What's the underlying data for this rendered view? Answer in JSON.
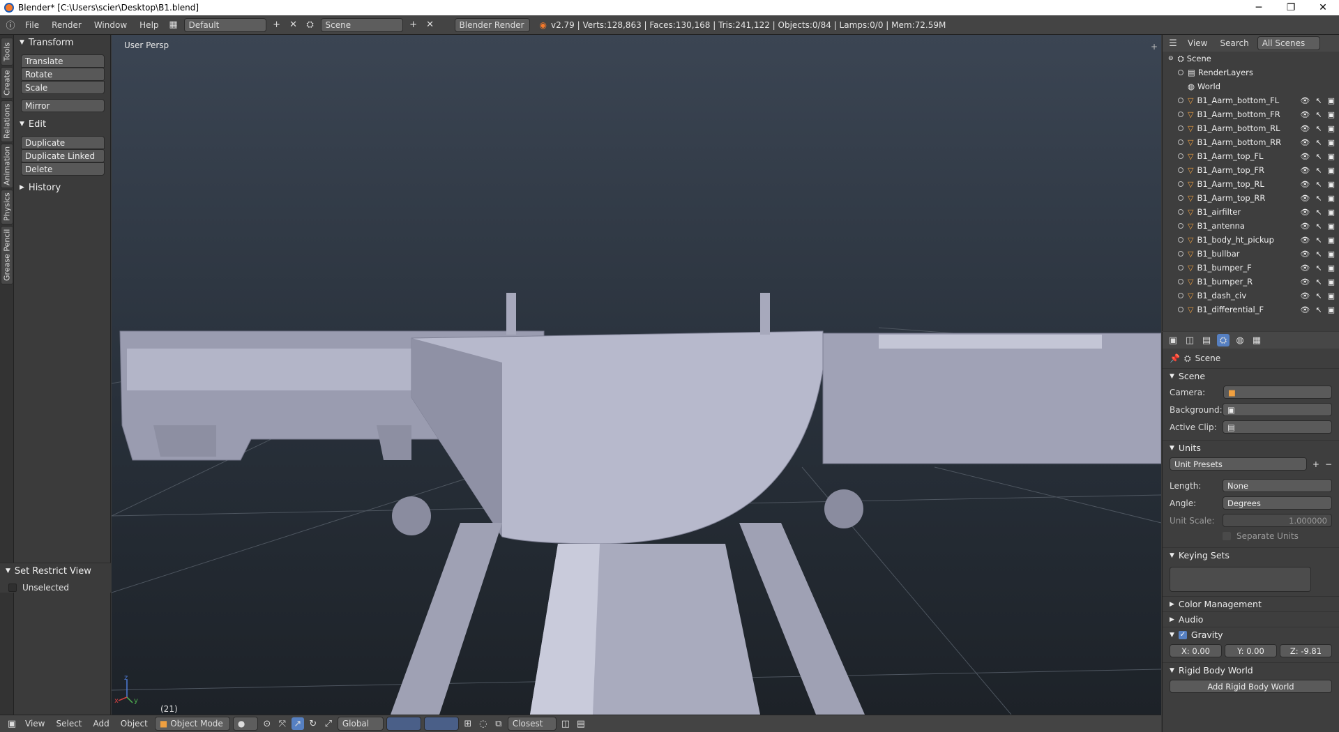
{
  "titlebar": {
    "title": "Blender* [C:\\Users\\scier\\Desktop\\B1.blend]",
    "min_label": "─",
    "max_label": "❐",
    "close_label": "✕"
  },
  "infobar": {
    "info_icon": "ⓘ",
    "menus": [
      "File",
      "Render",
      "Window",
      "Help"
    ],
    "layout": "Default",
    "scene": "Scene",
    "engine": "Blender Render",
    "stats": "v2.79 | Verts:128,863 | Faces:130,168 | Tris:241,122 | Objects:0/84 | Lamps:0/0 | Mem:72.59M"
  },
  "tool_tabs": [
    "Tools",
    "Create",
    "Relations",
    "Animation",
    "Physics",
    "Grease Pencil"
  ],
  "toolshelf": {
    "transform_header": "Transform",
    "transform_items": [
      "Translate",
      "Rotate",
      "Scale"
    ],
    "mirror": "Mirror",
    "edit_header": "Edit",
    "edit_items": [
      "Duplicate",
      "Duplicate Linked",
      "Delete"
    ],
    "history_header": "History",
    "restrict_header": "Set Restrict View",
    "unselected": "Unselected"
  },
  "viewport": {
    "label": "User Persp",
    "frame": "(21)",
    "axis_x": "x",
    "axis_y": "y",
    "axis_z": "z"
  },
  "view3d_header": {
    "menus": [
      "View",
      "Select",
      "Add",
      "Object"
    ],
    "mode": "Object Mode",
    "orientation": "Global",
    "snap_target": "Closest"
  },
  "outliner": {
    "header": {
      "view": "View",
      "search": "Search",
      "filter": "All Scenes"
    },
    "scene": "Scene",
    "render_layers": "RenderLayers",
    "world": "World",
    "objects": [
      "B1_Aarm_bottom_FL",
      "B1_Aarm_bottom_FR",
      "B1_Aarm_bottom_RL",
      "B1_Aarm_bottom_RR",
      "B1_Aarm_top_FL",
      "B1_Aarm_top_FR",
      "B1_Aarm_top_RL",
      "B1_Aarm_top_RR",
      "B1_airfilter",
      "B1_antenna",
      "B1_body_ht_pickup",
      "B1_bullbar",
      "B1_bumper_F",
      "B1_bumper_R",
      "B1_dash_civ",
      "B1_differential_F"
    ]
  },
  "properties": {
    "context": "Scene",
    "scene_section": "Scene",
    "camera_label": "Camera:",
    "background_label": "Background:",
    "active_clip_label": "Active Clip:",
    "units_section": "Units",
    "unit_presets": "Unit Presets",
    "length_label": "Length:",
    "length_value": "None",
    "angle_label": "Angle:",
    "angle_value": "Degrees",
    "unit_scale_label": "Unit Scale:",
    "unit_scale_value": "1.000000",
    "separate_units": "Separate Units",
    "keying_sets_section": "Keying Sets",
    "color_management": "Color Management",
    "audio": "Audio",
    "gravity": "Gravity",
    "gx": "X:  0.00",
    "gy": "Y:  0.00",
    "gz": "Z:  -9.81",
    "rigid_body_world": "Rigid Body World",
    "add_rigid_body_world": "Add Rigid Body World"
  },
  "colors": {
    "mesh_icon": "#f0a040",
    "viewport_top": "#3b4553",
    "viewport_bottom": "#1d2228"
  }
}
